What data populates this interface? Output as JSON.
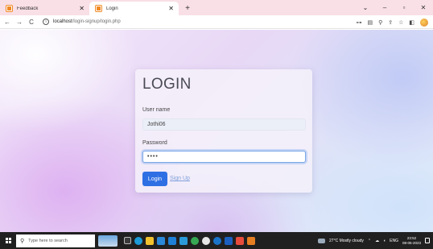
{
  "browser": {
    "tabs": [
      {
        "label": "Feedback",
        "active": false
      },
      {
        "label": "Login",
        "active": true
      }
    ],
    "new_tab": "+",
    "window_controls": {
      "chevron": "⌄",
      "minimize": "–",
      "maximize": "▫",
      "close": "✕"
    },
    "address": {
      "host": "localhost",
      "path": "/login-signup/login.php"
    },
    "nav": {
      "back": "←",
      "forward": "→",
      "reload": "C"
    }
  },
  "login": {
    "title": "LOGIN",
    "username_label": "User name",
    "username_value": "Jothi06",
    "password_label": "Password",
    "password_value": "••••",
    "login_button": "Login",
    "signup_link": "Sign Up"
  },
  "taskbar": {
    "search_placeholder": "Type here to search",
    "weather": "27°C  Mostly cloudy",
    "language": "ENG",
    "time": "23:52",
    "date": "08-05-2023"
  },
  "colors": {
    "accent": "#2f6fe4",
    "tab_bar": "#f9dfe6",
    "taskbar": "#202020"
  }
}
